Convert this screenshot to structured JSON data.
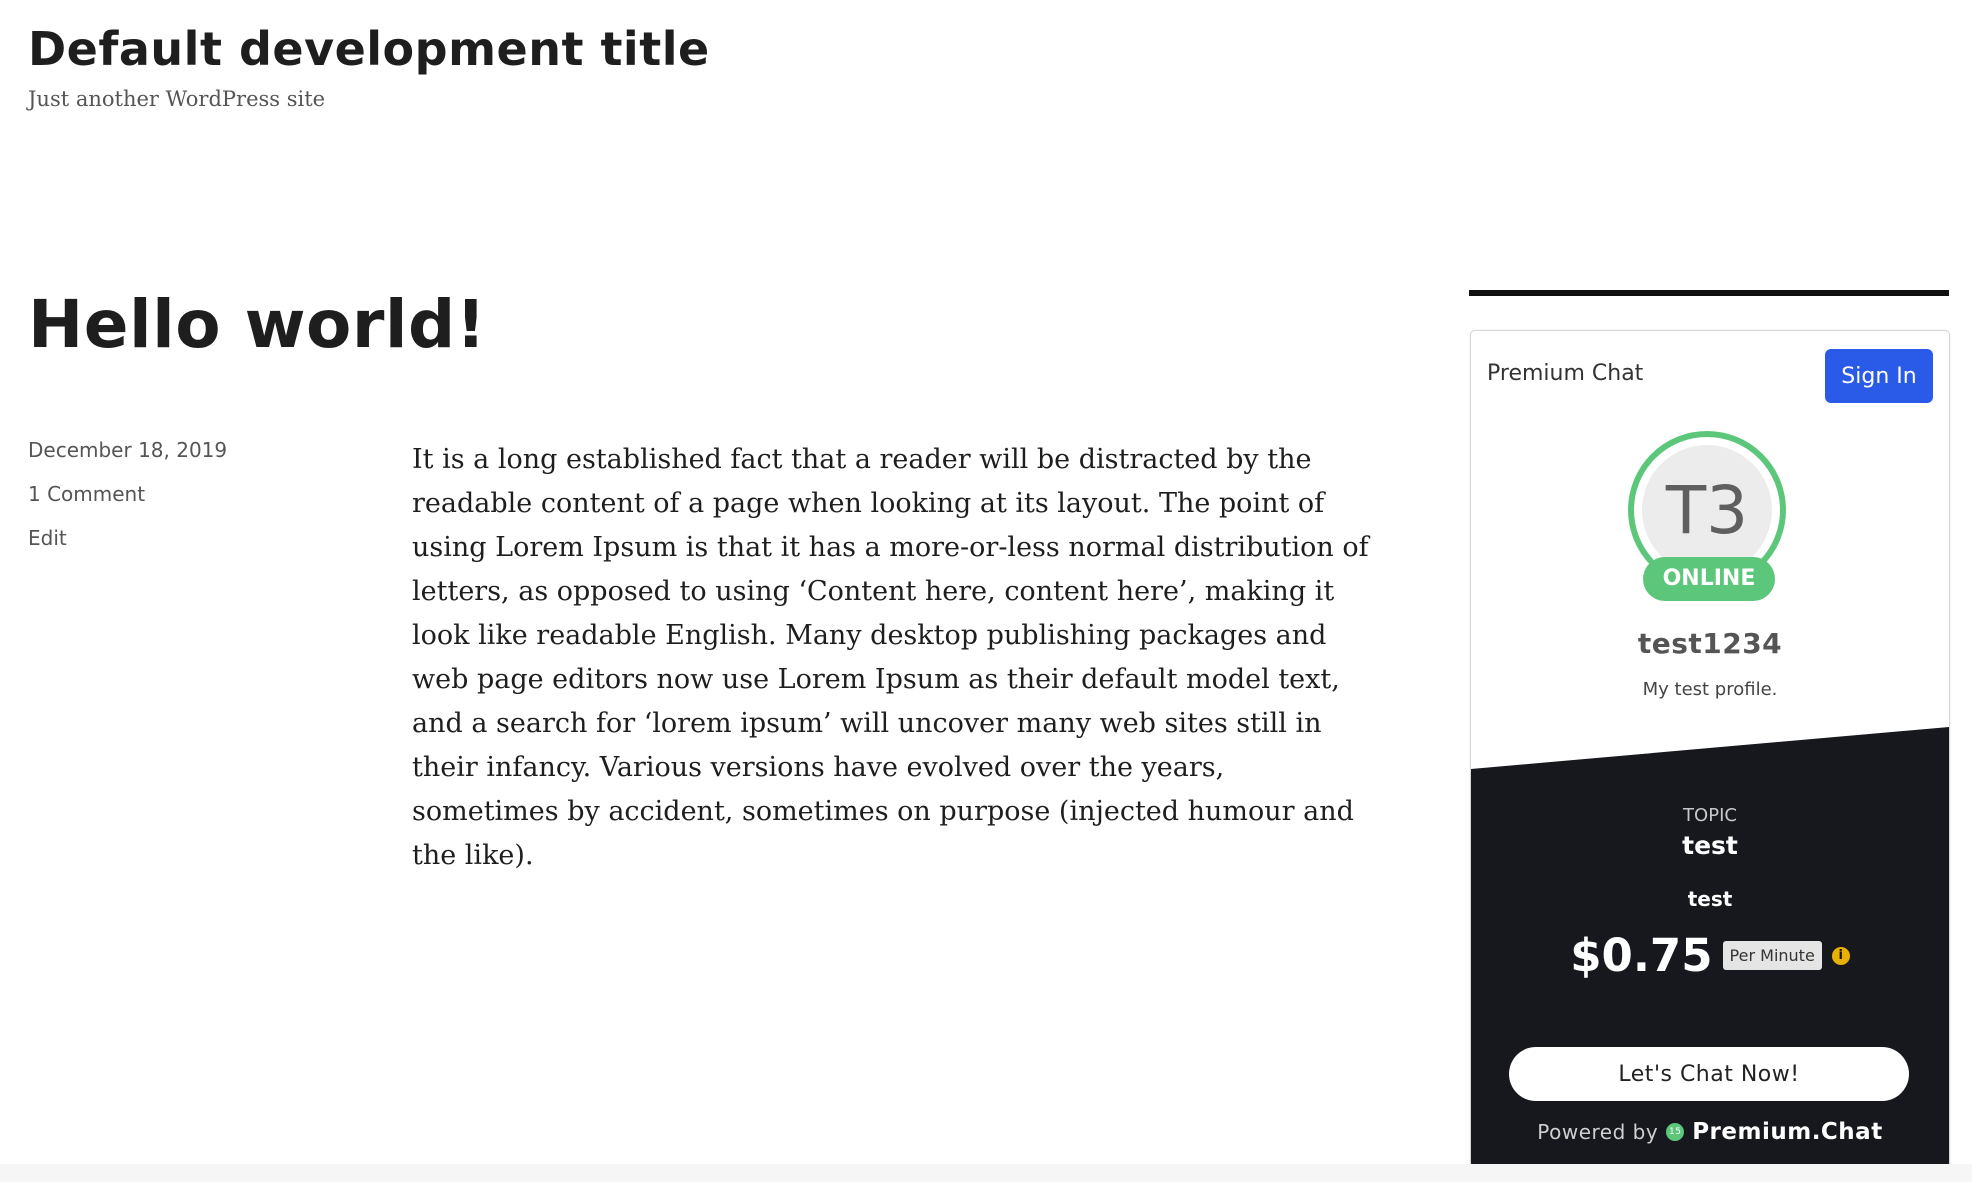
{
  "site": {
    "title": "Default development title",
    "description": "Just another WordPress site"
  },
  "post": {
    "title": "Hello world!",
    "date": "December 18, 2019",
    "comments": "1 Comment",
    "edit": "Edit",
    "body": "It is a long established fact that a reader will be distracted by the readable content of a page when looking at its layout. The point of using Lorem Ipsum is that it has a more-or-less normal distribution of letters, as opposed to using ‘Content here, content here’, making it look like readable English. Many desktop publishing packages and web page editors now use Lorem Ipsum as their default model text, and a search for ‘lorem ipsum’ will uncover many web sites still in their infancy. Various versions have evolved over the years, sometimes by accident, sometimes on purpose (injected humour and the like)."
  },
  "widget": {
    "title": "Premium Chat",
    "sign_in": "Sign In",
    "avatar_initials": "T3",
    "status": "ONLINE",
    "username": "test1234",
    "tagline": "My test profile.",
    "topic_label": "TOPIC",
    "topic_name": "test",
    "topic_description": "test",
    "price": "$0.75",
    "price_unit": "Per Minute",
    "info_icon": "i",
    "chat_button": "Let's Chat Now!",
    "powered_by": "Powered by",
    "logo_mark": "15",
    "brand": "Premium.Chat"
  },
  "colors": {
    "accent_blue": "#2a5ae8",
    "online_green": "#5cc77a",
    "dark_panel": "#16181d",
    "info_yellow": "#e8b000"
  }
}
